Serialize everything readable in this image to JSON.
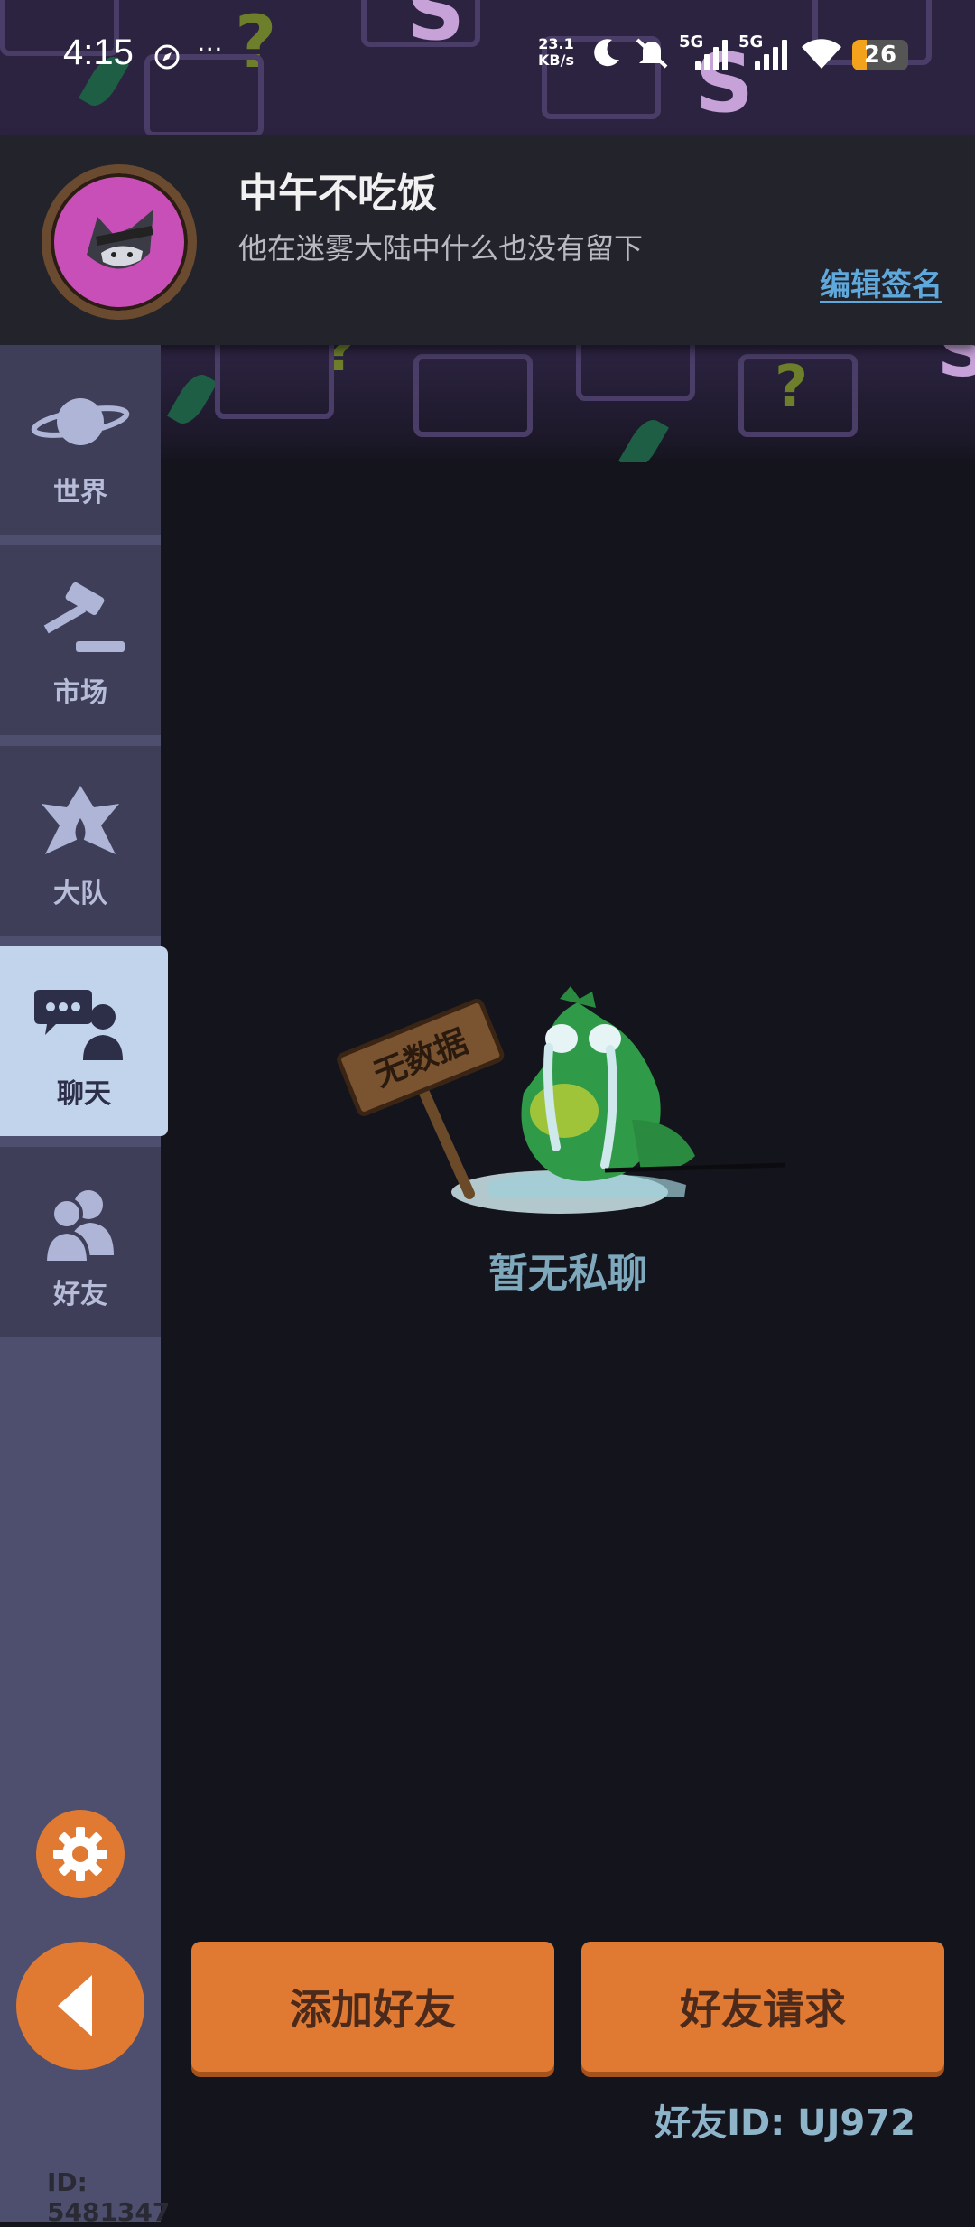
{
  "status_bar": {
    "time": "4:15",
    "net_speed_value": "23.1",
    "net_speed_unit": "KB/s",
    "signal_1_label": "5G",
    "signal_2_label": "5G",
    "battery_level": "26",
    "battery_color": "#f2a31b"
  },
  "profile": {
    "name": "中午不吃饭",
    "signature": "他在迷雾大陆中什么也没有留下",
    "edit_signature_label": "编辑签名",
    "avatar_icon": "masked-raccoon-avatar"
  },
  "sidebar": {
    "items": [
      {
        "label": "世界",
        "icon": "planet-icon"
      },
      {
        "label": "市场",
        "icon": "gavel-icon"
      },
      {
        "label": "大队",
        "icon": "team-emblem-icon"
      },
      {
        "label": "聊天",
        "icon": "chat-person-icon"
      },
      {
        "label": "好友",
        "icon": "friends-icon"
      }
    ],
    "active_index": 3,
    "settings_icon": "gear-icon",
    "back_icon": "back-arrow-icon"
  },
  "empty_state": {
    "sign_text": "无数据",
    "message": "暂无私聊"
  },
  "actions": {
    "add_friend_label": "添加好友",
    "friend_requests_label": "好友请求"
  },
  "friend_id_label": "好友ID: UJ972",
  "user_id_label": "ID: 5481347",
  "colors": {
    "accent_orange": "#e07a33",
    "sidebar_bg": "#4e4e6e",
    "active_tab_bg": "#c2d4ec",
    "link_blue": "#5fa8dc"
  }
}
